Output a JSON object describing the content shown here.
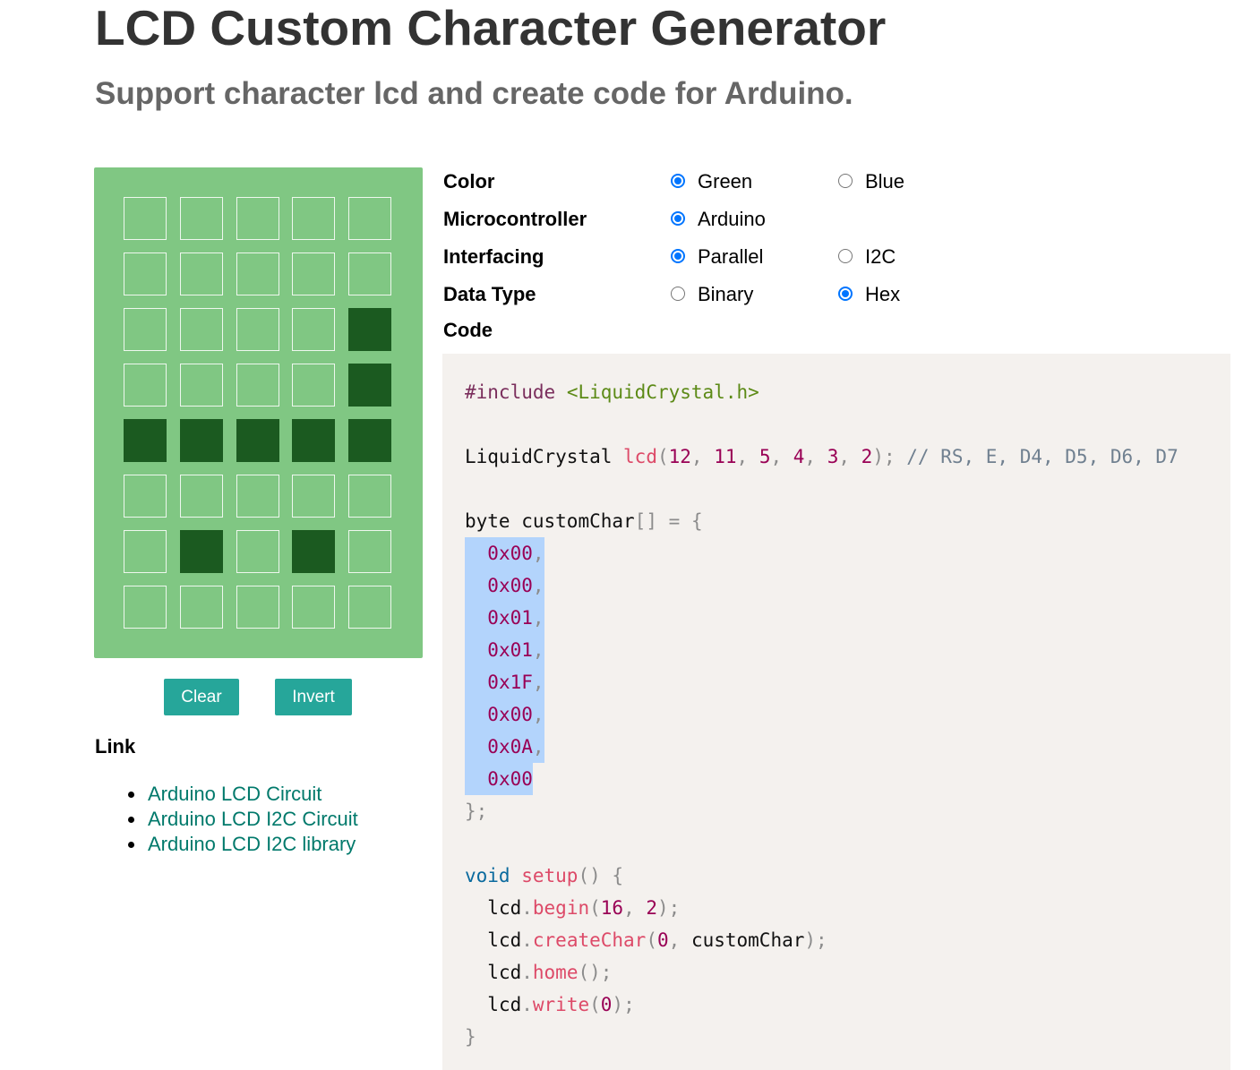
{
  "header": {
    "title": "LCD Custom Character Generator",
    "subtitle": "Support character lcd and create code for Arduino."
  },
  "lcd": {
    "pixel_on_color": "#1b5a20",
    "panel_color": "#80c783",
    "rows": [
      [
        0,
        0,
        0,
        0,
        0
      ],
      [
        0,
        0,
        0,
        0,
        0
      ],
      [
        0,
        0,
        0,
        0,
        1
      ],
      [
        0,
        0,
        0,
        0,
        1
      ],
      [
        1,
        1,
        1,
        1,
        1
      ],
      [
        0,
        0,
        0,
        0,
        0
      ],
      [
        0,
        1,
        0,
        1,
        0
      ],
      [
        0,
        0,
        0,
        0,
        0
      ]
    ]
  },
  "buttons": {
    "clear": "Clear",
    "invert": "Invert",
    "color": "#26a69a"
  },
  "links": {
    "heading": "Link",
    "items": [
      "Arduino LCD Circuit",
      "Arduino LCD I2C Circuit",
      "Arduino LCD I2C library"
    ]
  },
  "options": {
    "color": {
      "label": "Color",
      "choices": [
        "Green",
        "Blue"
      ],
      "selected": "Green"
    },
    "microcontroller": {
      "label": "Microcontroller",
      "choices": [
        "Arduino"
      ],
      "selected": "Arduino"
    },
    "interfacing": {
      "label": "Interfacing",
      "choices": [
        "Parallel",
        "I2C"
      ],
      "selected": "Parallel"
    },
    "data_type": {
      "label": "Data Type",
      "choices": [
        "Binary",
        "Hex"
      ],
      "selected": "Hex"
    },
    "code_label": "Code"
  },
  "code": {
    "include_directive": "#include",
    "include_file": "<LiquidCrystal.h>",
    "lcd_type": "LiquidCrystal",
    "lcd_name": "lcd",
    "lcd_pins": [
      "12",
      "11",
      "5",
      "4",
      "3",
      "2"
    ],
    "lcd_comment": "// RS, E, D4, D5, D6, D7",
    "array_type": "byte",
    "array_name": "customChar",
    "hex_values": [
      "0x00",
      "0x00",
      "0x01",
      "0x01",
      "0x1F",
      "0x00",
      "0x0A",
      "0x00"
    ],
    "void_kw": "void",
    "setup_fn": "setup",
    "obj": "lcd",
    "begin_fn": "begin",
    "begin_args": [
      "16",
      "2"
    ],
    "create_fn": "createChar",
    "create_arg0": "0",
    "create_arg1": "customChar",
    "home_fn": "home",
    "write_fn": "write",
    "write_arg": "0"
  }
}
